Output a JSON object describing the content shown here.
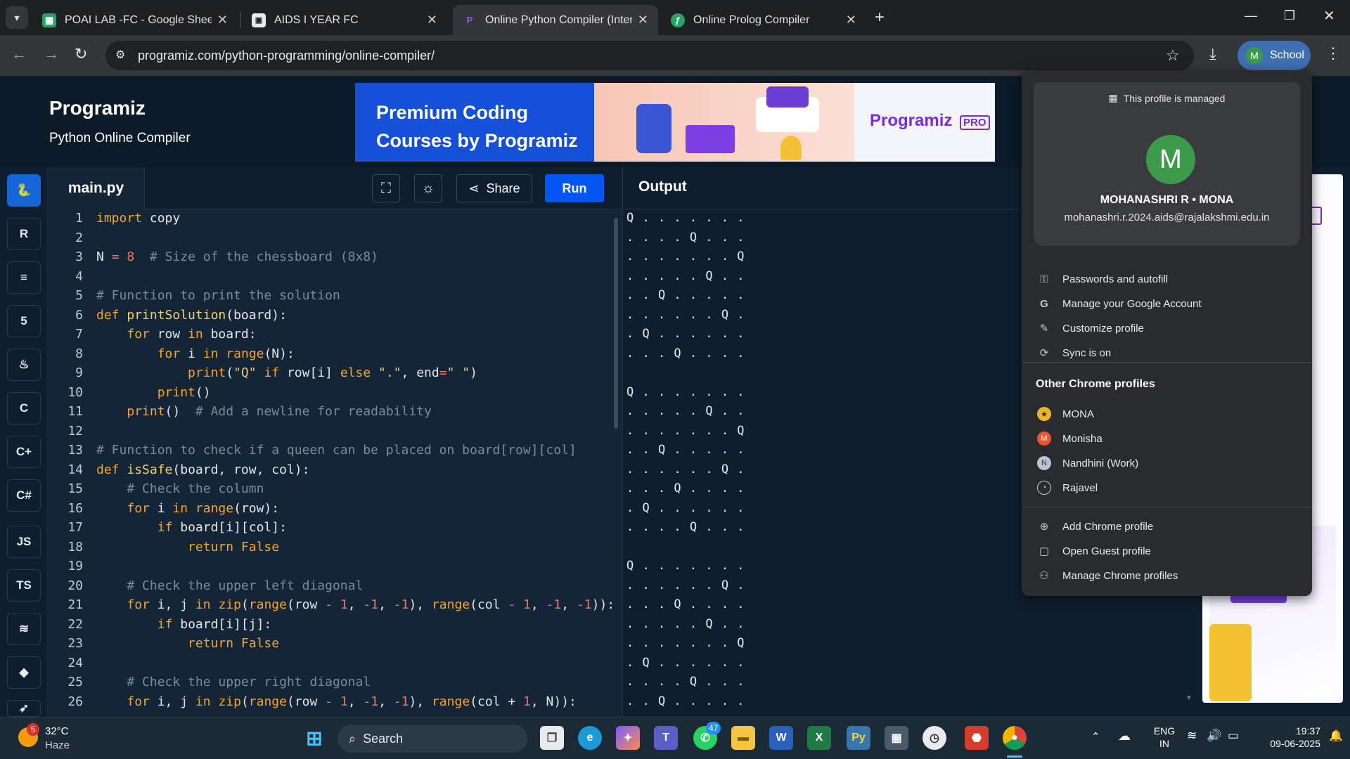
{
  "browser": {
    "tabs": [
      {
        "title": "POAI LAB -FC - Google Sheets",
        "active": false
      },
      {
        "title": "AIDS I YEAR FC",
        "active": false
      },
      {
        "title": "Online Python Compiler (Interp",
        "active": true
      },
      {
        "title": "Online Prolog Compiler",
        "active": false
      }
    ],
    "url": "programiz.com/python-programming/online-compiler/",
    "profile_label": "School",
    "profile_initial": "M"
  },
  "page": {
    "logo": "Programiz",
    "subtitle": "Python Online Compiler",
    "banner_text": "Premium Coding Courses by Programiz",
    "banner_brand": "Programiz",
    "banner_brand_tag": "PRO",
    "languages": [
      "python",
      "R",
      "db",
      "html",
      "java",
      "C",
      "C++",
      "C#",
      "JS",
      "TS",
      "swift",
      "rust",
      "go"
    ],
    "file_tab": "main.py",
    "share_label": "Share",
    "run_label": "Run",
    "output_title": "Output"
  },
  "code_lines": [
    "import copy",
    "",
    "N = 8  # Size of the chessboard (8x8)",
    "",
    "# Function to print the solution",
    "def printSolution(board):",
    "    for row in board:",
    "        for i in range(N):",
    "            print(\"Q\" if row[i] else \".\", end=\" \")",
    "        print()",
    "    print()  # Add a newline for readability",
    "",
    "# Function to check if a queen can be placed on board[row][col]",
    "def isSafe(board, row, col):",
    "    # Check the column",
    "    for i in range(row):",
    "        if board[i][col]:",
    "            return False",
    "",
    "    # Check the upper left diagonal",
    "    for i, j in zip(range(row - 1, -1, -1), range(col - 1, -1, -1)):",
    "        if board[i][j]:",
    "            return False",
    "",
    "    # Check the upper right diagonal",
    "    for i, j in zip(range(row - 1, -1, -1), range(col + 1, N)):"
  ],
  "output_lines": [
    "Q . . . . . . .",
    ". . . . Q . . .",
    ". . . . . . . Q",
    ". . . . . Q . .",
    ". . Q . . . . .",
    ". . . . . . Q .",
    ". Q . . . . . .",
    ". . . Q . . . .",
    "",
    "Q . . . . . . .",
    ". . . . . Q . .",
    ". . . . . . . Q",
    ". . Q . . . . .",
    ". . . . . . Q .",
    ". . . Q . . . .",
    ". Q . . . . . .",
    ". . . . Q . . .",
    "",
    "Q . . . . . . .",
    ". . . . . . Q .",
    ". . . Q . . . .",
    ". . . . . Q . .",
    ". . . . . . . Q",
    ". Q . . . . . .",
    ". . . . Q . . .",
    ". . Q . . . . ."
  ],
  "profile_menu": {
    "managed_text": "This profile is managed",
    "avatar_initial": "M",
    "name": "MOHANASHRI   R • MONA",
    "email": "mohanashri.r.2024.aids@rajalakshmi.edu.in",
    "items": [
      "Passwords and autofill",
      "Manage your Google Account",
      "Customize profile",
      "Sync is on"
    ],
    "other_header": "Other Chrome profiles",
    "other_profiles": [
      "MONA",
      "Monisha",
      "Nandhini (Work)",
      "Rajavel"
    ],
    "footer_items": [
      "Add Chrome profile",
      "Open Guest profile",
      "Manage Chrome profiles"
    ]
  },
  "taskbar": {
    "weather_temp": "32°C",
    "weather_desc": "Haze",
    "weather_badge": "5",
    "search_label": "Search",
    "whatsapp_badge": "47",
    "lang_line1": "ENG",
    "lang_line2": "IN",
    "time": "19:37",
    "date": "09-06-2025"
  },
  "colors": {
    "accent": "#0556f3",
    "page_bg": "#0f1e2e",
    "editor_bg": "#142538",
    "keyword": "#f5a623",
    "comment": "#7c8a99",
    "profile_green": "#3c9b4a"
  }
}
